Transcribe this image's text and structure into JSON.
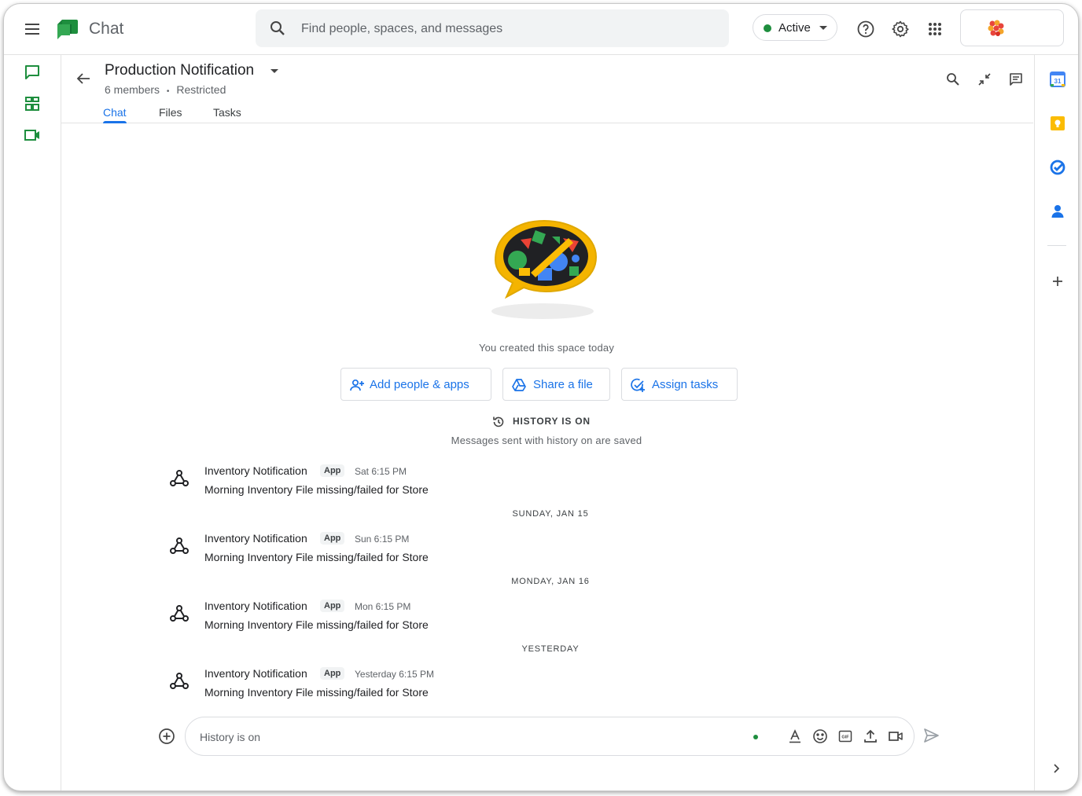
{
  "app": {
    "title": "Chat"
  },
  "search": {
    "placeholder": "Find people, spaces, and messages"
  },
  "status": {
    "label": "Active",
    "color": "#1e8e3e"
  },
  "space": {
    "title": "Production Notification",
    "members": "6 members",
    "separator": "•",
    "access": "Restricted",
    "tabs": [
      {
        "label": "Chat",
        "active": true
      },
      {
        "label": "Files",
        "active": false
      },
      {
        "label": "Tasks",
        "active": false
      }
    ]
  },
  "intro": {
    "created_text": "You created this space today",
    "actions": [
      {
        "label": "Add people & apps",
        "icon": "add-person-icon"
      },
      {
        "label": "Share a file",
        "icon": "drive-icon"
      },
      {
        "label": "Assign tasks",
        "icon": "task-icon"
      }
    ],
    "history_label": "HISTORY IS ON",
    "history_sub": "Messages sent with history on are saved"
  },
  "messages": [
    {
      "sender": "Inventory Notification",
      "badge": "App",
      "time": "Sat 6:15 PM",
      "body": "Morning Inventory File missing/failed for Store"
    },
    {
      "sender": "Inventory Notification",
      "badge": "App",
      "time": "Sun 6:15 PM",
      "body": "Morning Inventory File missing/failed for Store"
    },
    {
      "sender": "Inventory Notification",
      "badge": "App",
      "time": "Mon 6:15 PM",
      "body": "Morning Inventory File missing/failed for Store"
    },
    {
      "sender": "Inventory Notification",
      "badge": "App",
      "time": "Yesterday 6:15 PM",
      "body": "Morning Inventory File missing/failed for Store"
    }
  ],
  "date_separators": [
    "SUNDAY, JAN 15",
    "MONDAY, JAN 16",
    "YESTERDAY"
  ],
  "compose": {
    "placeholder": "History is on"
  },
  "colors": {
    "accent": "#1a73e8",
    "rail_green": "#1e8e3e",
    "keep_yellow": "#fbbc04"
  }
}
